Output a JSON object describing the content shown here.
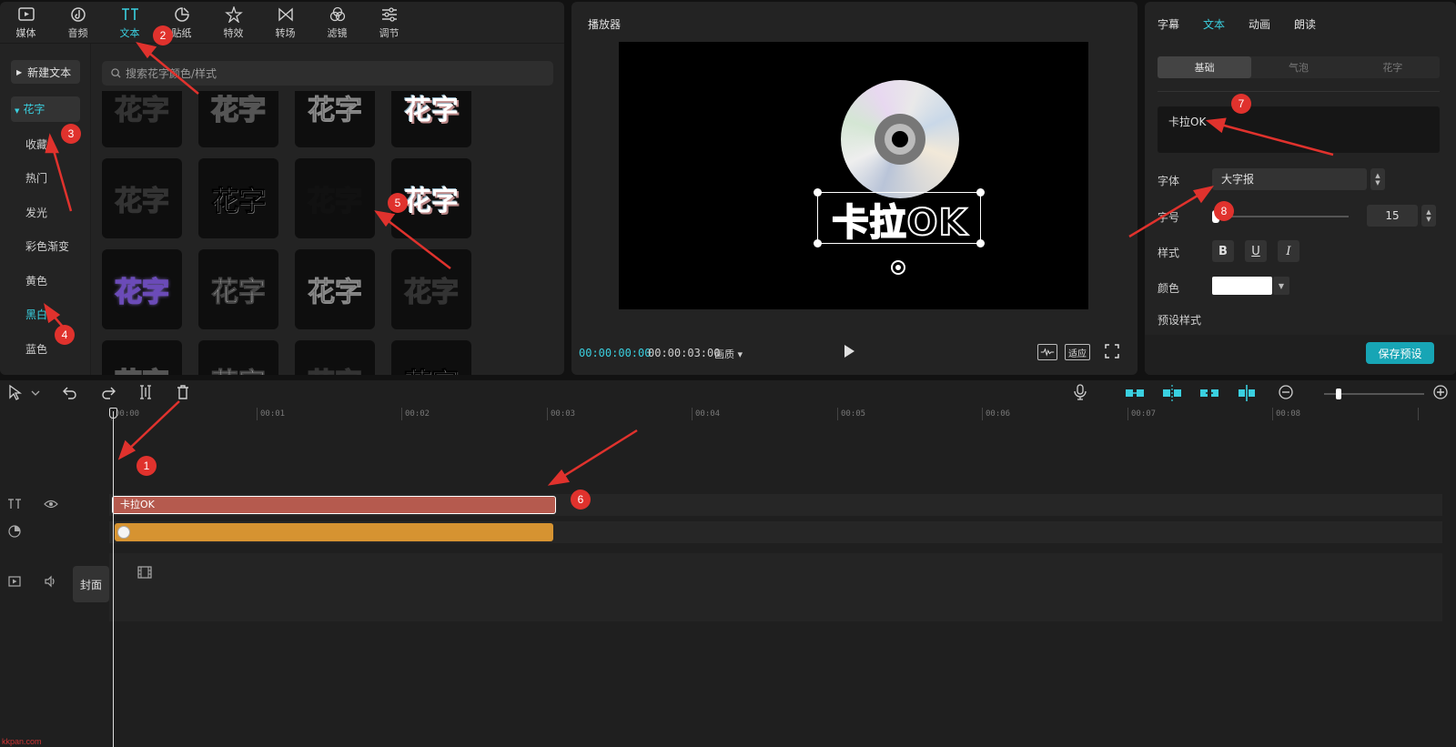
{
  "top_tabs": [
    {
      "label": "媒体",
      "icon": "media-icon"
    },
    {
      "label": "音频",
      "icon": "audio-icon"
    },
    {
      "label": "文本",
      "icon": "text-icon",
      "active": true
    },
    {
      "label": "贴纸",
      "icon": "sticker-icon"
    },
    {
      "label": "特效",
      "icon": "effects-icon"
    },
    {
      "label": "转场",
      "icon": "transition-icon"
    },
    {
      "label": "滤镜",
      "icon": "filter-icon"
    },
    {
      "label": "调节",
      "icon": "adjust-icon"
    }
  ],
  "sidebar": {
    "new_text": "新建文本",
    "categories": [
      "花字",
      "收藏",
      "热门",
      "发光",
      "彩色渐变",
      "黄色",
      "黑白",
      "蓝色"
    ]
  },
  "search": {
    "placeholder": "搜索花字颜色/样式"
  },
  "thumb_text": "花字",
  "player": {
    "title": "播放器",
    "current_time": "00:00:00:00",
    "total_time": "00:00:03:00",
    "quality": "画质",
    "preview_text": "卡拉OK",
    "fit_label": "适应"
  },
  "props": {
    "tabs": [
      "字幕",
      "文本",
      "动画",
      "朗读"
    ],
    "active_tab": "文本",
    "subtabs": [
      "基础",
      "气泡",
      "花字"
    ],
    "text_value": "卡拉OK",
    "font_label": "字体",
    "font_value": "大字报",
    "size_label": "字号",
    "size_value": "15",
    "style_label": "样式",
    "color_label": "颜色",
    "color_value": "#ffffff",
    "preset_label": "预设样式",
    "save_preset": "保存预设"
  },
  "timeline": {
    "ruler": [
      "00:00",
      "00:01",
      "00:02",
      "00:03",
      "00:04",
      "00:05",
      "00:06",
      "00:07",
      "00:08"
    ],
    "text_clip": "卡拉OK",
    "cover_label": "封面"
  },
  "annotations": [
    "1",
    "2",
    "3",
    "4",
    "5",
    "6",
    "7",
    "8"
  ],
  "watermark": "kkpan.com",
  "colors": {
    "accent": "#3ad0e0",
    "text_clip": "#b55a4e",
    "effect_clip": "#d69331",
    "save_button": "#17a5b5",
    "annotation": "#e0322d"
  }
}
